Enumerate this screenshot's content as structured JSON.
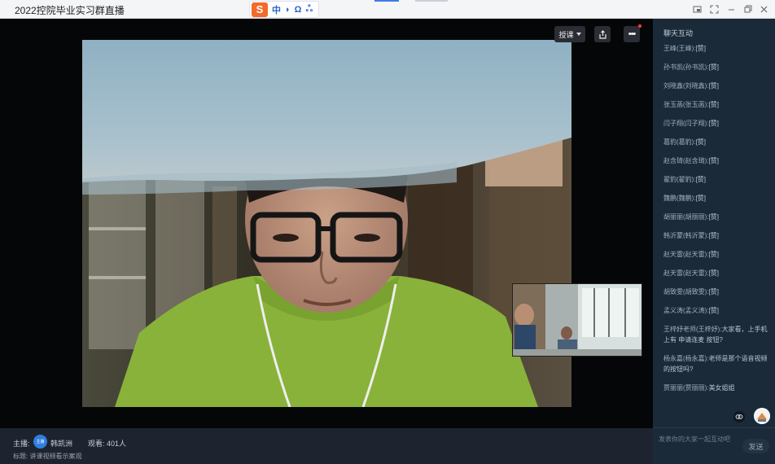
{
  "window": {
    "title": "2022控院毕业实习群直播",
    "ime": {
      "logo": "S",
      "glyphs": [
        "中",
        "◗",
        "Ω",
        "ஃ"
      ]
    }
  },
  "stage": {
    "mode_select": "授课",
    "more_label": "•••"
  },
  "info": {
    "host_label": "主播:",
    "host_avatar_text": "主播",
    "host_name": "韩凯洲",
    "viewers": "观看: 401人",
    "topic": "标题: 讲课视频看示案观"
  },
  "chat": {
    "title": "聊天互动",
    "messages": [
      {
        "user": "王峰(王峰):",
        "text": "[赞]"
      },
      {
        "user": "孙书凯(孙书凯):",
        "text": "[赞]"
      },
      {
        "user": "刘晓鑫(刘晓鑫):",
        "text": "[赞]"
      },
      {
        "user": "张玉菡(张玉菡):",
        "text": "[赞]"
      },
      {
        "user": "闫子翔(闫子翔):",
        "text": "[赞]"
      },
      {
        "user": "葛豹(葛豹):",
        "text": "[赞]"
      },
      {
        "user": "赵含琦(赵含琦):",
        "text": "[赞]"
      },
      {
        "user": "翟豹(翟豹):",
        "text": "[赞]"
      },
      {
        "user": "魏鹏(魏鹏):",
        "text": "[赞]"
      },
      {
        "user": "胡丽丽(胡丽丽):",
        "text": "[赞]"
      },
      {
        "user": "韩沂蒙(韩沂蒙):",
        "text": "[赞]"
      },
      {
        "user": "赵天雷(赵天雷):",
        "text": "[赞]"
      },
      {
        "user": "赵天雷(赵天雷):",
        "text": "[赞]"
      },
      {
        "user": "胡致雯(胡致雯):",
        "text": "[赞]"
      },
      {
        "user": "孟义涛(孟义涛):",
        "text": "[赞]"
      },
      {
        "user": "王梓妤老师(王梓妤):",
        "text": "大家看，上手机上有 申请连麦 按钮?"
      },
      {
        "user": "杨永嘉(杨永嘉):",
        "text": "老师是那个语音视频的按钮吗?"
      },
      {
        "user": "贾丽丽(贾丽丽):",
        "text": "美女姐姐"
      }
    ],
    "input_placeholder": "发表你的大家一起互动吧",
    "send_label": "发送"
  }
}
